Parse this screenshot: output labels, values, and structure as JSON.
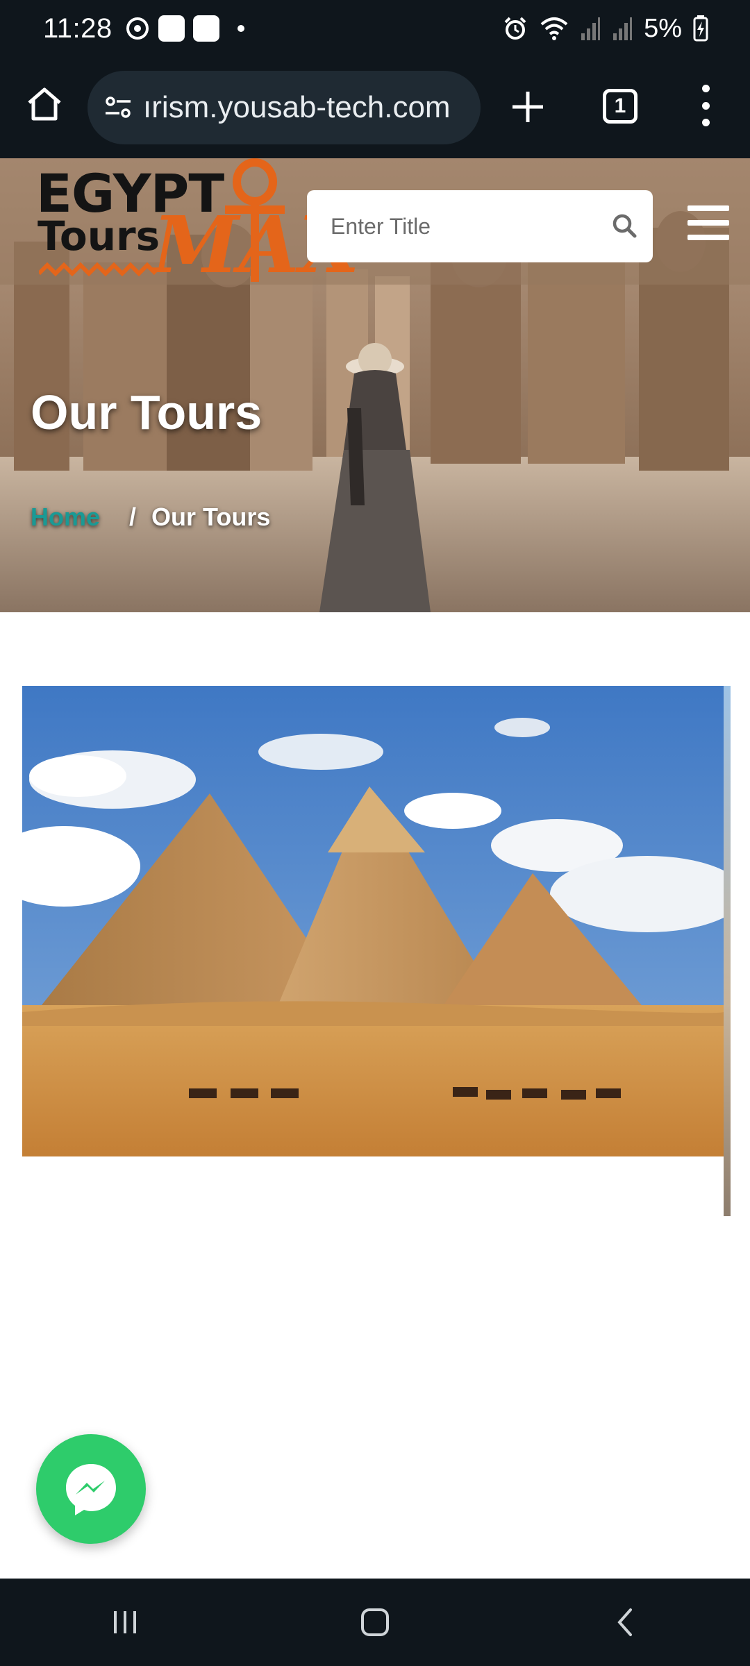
{
  "status_bar": {
    "time": "11:28",
    "battery": "5%"
  },
  "browser": {
    "url": "ırism.yousab-tech.com",
    "tab_count": "1"
  },
  "header": {
    "logo": {
      "line1": "EGYPT",
      "line2": "Tours",
      "accent": "MAX"
    },
    "search_placeholder": "Enter Title"
  },
  "hero": {
    "title": "Our Tours",
    "breadcrumb": {
      "home": "Home",
      "separator": "/",
      "current": "Our Tours"
    }
  },
  "icons": {
    "home": "home-icon",
    "tune": "tune-icon",
    "plus": "plus-icon",
    "tabs": "tabs-icon",
    "menu": "more-vert-icon",
    "search": "search-icon",
    "hamburger": "hamburger-icon",
    "messenger": "messenger-icon"
  },
  "colors": {
    "system_bar": "#0f161c",
    "breadcrumb_home": "#1a9a95",
    "logo_accent": "#e4651a",
    "messenger": "#2ecc6b"
  }
}
